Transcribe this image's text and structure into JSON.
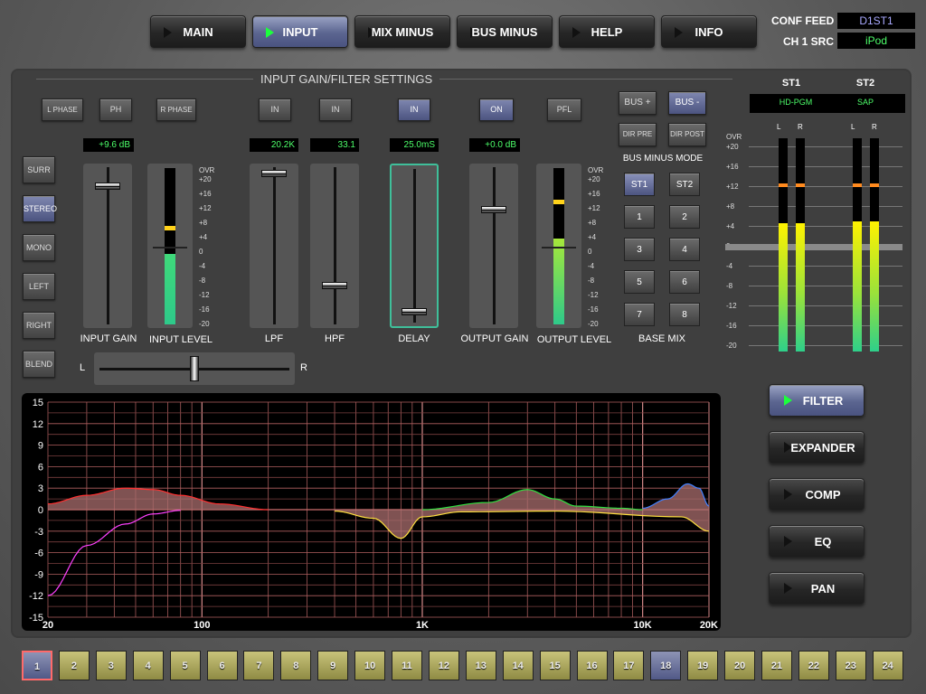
{
  "nav": {
    "items": [
      {
        "label": "MAIN",
        "active": false
      },
      {
        "label": "INPUT",
        "active": true
      },
      {
        "label": "MIX MINUS",
        "active": false
      },
      {
        "label": "BUS MINUS",
        "active": false
      },
      {
        "label": "HELP",
        "active": false
      },
      {
        "label": "INFO",
        "active": false
      }
    ]
  },
  "top_info": {
    "conf_feed_label": "CONF FEED",
    "conf_feed_value": "D1ST1",
    "ch_src_label": "CH 1 SRC",
    "ch_src_value": "iPod"
  },
  "panel": {
    "title": "INPUT GAIN/FILTER SETTINGS"
  },
  "mode_buttons": [
    "SURR",
    "STEREO",
    "MONO",
    "LEFT",
    "RIGHT",
    "BLEND"
  ],
  "active_mode": "STEREO",
  "phase_buttons": {
    "l_phase": "L PHASE",
    "ph": "PH",
    "r_phase": "R PHASE"
  },
  "in_buttons": {
    "lpf": "IN",
    "hpf": "IN",
    "delay": "IN",
    "on": "ON",
    "pfl": "PFL"
  },
  "readouts": {
    "input_gain": "+9.6 dB",
    "lpf": "20.2K",
    "hpf": "33.1",
    "delay": "25.0mS",
    "output_gain": "+0.0 dB"
  },
  "fader_labels": {
    "input_gain": "INPUT GAIN",
    "input_level": "INPUT LEVEL",
    "lpf": "LPF",
    "hpf": "HPF",
    "delay": "DELAY",
    "output_gain": "OUTPUT GAIN",
    "output_level": "OUTPUT LEVEL"
  },
  "meter_scale": [
    "OVR",
    "+20",
    "+16",
    "+12",
    "+8",
    "+4",
    "0",
    "-4",
    "-8",
    "-12",
    "-16",
    "-20"
  ],
  "levels": {
    "input_level": 0.45,
    "input_peak": 0.6,
    "output_level": 0.55,
    "output_peak": 0.77,
    "st1_l": 0.6,
    "st1_r": 0.6,
    "st2_l": 0.61,
    "st2_r": 0.61
  },
  "balance": {
    "left_label": "L",
    "right_label": "R",
    "position": 0.5
  },
  "bus": {
    "bus_plus": "BUS +",
    "bus_minus": "BUS -",
    "dir_pre": "DIR PRE",
    "dir_post": "DIR POST",
    "mode_label": "BUS MINUS MODE",
    "st1": "ST1",
    "st2": "ST2",
    "base_mix_label": "BASE MIX",
    "base_mix": [
      "1",
      "2",
      "3",
      "4",
      "5",
      "6",
      "7",
      "8"
    ]
  },
  "st_meters": {
    "st1_label": "ST1",
    "st2_label": "ST2",
    "st1_src": "HD-PGM",
    "st2_src": "SAP",
    "l": "L",
    "r": "R",
    "scale": [
      "OVR",
      "+20",
      "+16",
      "+12",
      "+8",
      "+4",
      "0",
      "-4",
      "-8",
      "-12",
      "-16",
      "-20"
    ]
  },
  "right_buttons": [
    {
      "label": "FILTER",
      "active": true
    },
    {
      "label": "EXPANDER",
      "active": false
    },
    {
      "label": "COMP",
      "active": false
    },
    {
      "label": "EQ",
      "active": false
    },
    {
      "label": "PAN",
      "active": false
    }
  ],
  "chart_data": {
    "type": "line",
    "x_scale": "log",
    "xlim": [
      20,
      20000
    ],
    "ylim": [
      -15,
      15
    ],
    "x_ticks": [
      "20",
      "100",
      "1K",
      "10K",
      "20K"
    ],
    "y_ticks": [
      "15",
      "12",
      "9",
      "6",
      "3",
      "0",
      "-3",
      "-6",
      "-9",
      "-12",
      "-15"
    ],
    "series": [
      {
        "color": "#ff3030",
        "x": [
          20,
          30,
          45,
          60,
          80,
          120,
          200
        ],
        "y": [
          0.8,
          2.0,
          3.0,
          2.8,
          2.0,
          0.8,
          0
        ]
      },
      {
        "color": "#ff40ff",
        "x": [
          20,
          30,
          45,
          60,
          80
        ],
        "y": [
          -12,
          -5,
          -2,
          -0.6,
          -0.1
        ]
      },
      {
        "color": "#ffe040",
        "x": [
          400,
          600,
          800,
          1000,
          1500,
          4000,
          15000,
          20000
        ],
        "y": [
          -0.2,
          -1.2,
          -4.0,
          -1.0,
          -0.3,
          -0.2,
          -1.0,
          -3.0
        ]
      },
      {
        "color": "#30e040",
        "x": [
          1000,
          2000,
          3000,
          4000,
          5000,
          8000,
          10000
        ],
        "y": [
          0,
          1.0,
          2.8,
          1.5,
          0.5,
          0.2,
          0
        ]
      },
      {
        "color": "#4080ff",
        "x": [
          10000,
          13000,
          16000,
          18000,
          20000
        ],
        "y": [
          0.2,
          1.5,
          3.6,
          3.0,
          0.5
        ]
      }
    ]
  },
  "channels": [
    "1",
    "2",
    "3",
    "4",
    "5",
    "6",
    "7",
    "8",
    "9",
    "10",
    "11",
    "12",
    "13",
    "14",
    "15",
    "16",
    "17",
    "18",
    "19",
    "20",
    "21",
    "22",
    "23",
    "24"
  ],
  "selected_channels": [
    "18"
  ],
  "current_channel": "1"
}
